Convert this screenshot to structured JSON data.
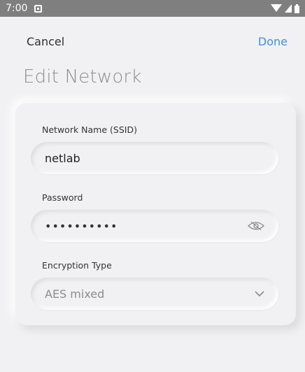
{
  "status_bar": {
    "time": "7:00"
  },
  "nav": {
    "cancel_label": "Cancel",
    "done_label": "Done"
  },
  "page": {
    "title": "Edit Network"
  },
  "form": {
    "ssid": {
      "label": "Network Name (SSID)",
      "value": "netlab"
    },
    "password": {
      "label": "Password",
      "value": "••••••••••",
      "toggle_icon": "eye-icon"
    },
    "encryption": {
      "label": "Encryption Type",
      "value": "AES mixed",
      "dropdown_icon": "chevron-down-icon"
    }
  },
  "colors": {
    "accent": "#3f8fe2",
    "background": "#f1f1f3",
    "status_bar": "#7f7f7f"
  }
}
